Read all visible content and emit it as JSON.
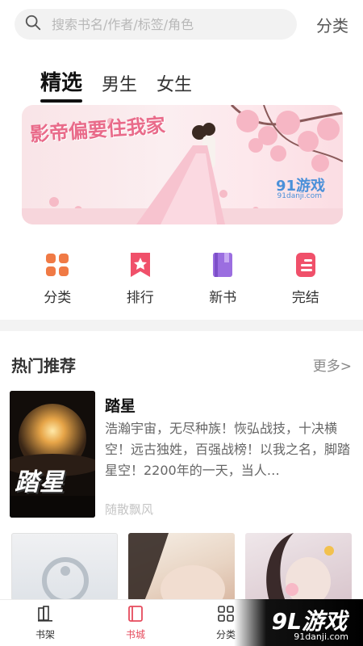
{
  "search": {
    "placeholder": "搜索书名/作者/标签/角色"
  },
  "header": {
    "category_label": "分类"
  },
  "tabs": [
    {
      "label": "精选"
    },
    {
      "label": "男生"
    },
    {
      "label": "女生"
    }
  ],
  "banner": {
    "title": "影帝偏要住我家",
    "brand": "91游戏",
    "brand_sub": "91danji.com"
  },
  "quick_nav": [
    {
      "label": "分类",
      "icon": "grid-icon",
      "color": "#f07a45"
    },
    {
      "label": "排行",
      "icon": "ranking-star-icon",
      "color": "#f0506a"
    },
    {
      "label": "新书",
      "icon": "new-book-icon",
      "color": "#9b6ee0"
    },
    {
      "label": "完结",
      "icon": "finished-book-icon",
      "color": "#f0506a"
    }
  ],
  "hot": {
    "title": "热门推荐",
    "more_label": "更多>",
    "featured": {
      "cover_title": "踏星",
      "title": "踏星",
      "description": "浩瀚宇宙，无尽种族！恢弘战技，十决横空！远古独姓，百强战榜！以我之名，脚踏星空！2200年的一天，当人…",
      "author": "随散飘风"
    }
  },
  "bottom_nav": [
    {
      "label": "书架",
      "icon": "bookshelf-icon"
    },
    {
      "label": "书城",
      "icon": "bookstore-icon",
      "active": true
    },
    {
      "label": "分类",
      "icon": "category-grid-icon"
    }
  ],
  "watermark": {
    "main": "9L游戏",
    "sub": "91danji.com"
  },
  "colors": {
    "accent": "#e64a5c",
    "more_link": "#888888"
  }
}
